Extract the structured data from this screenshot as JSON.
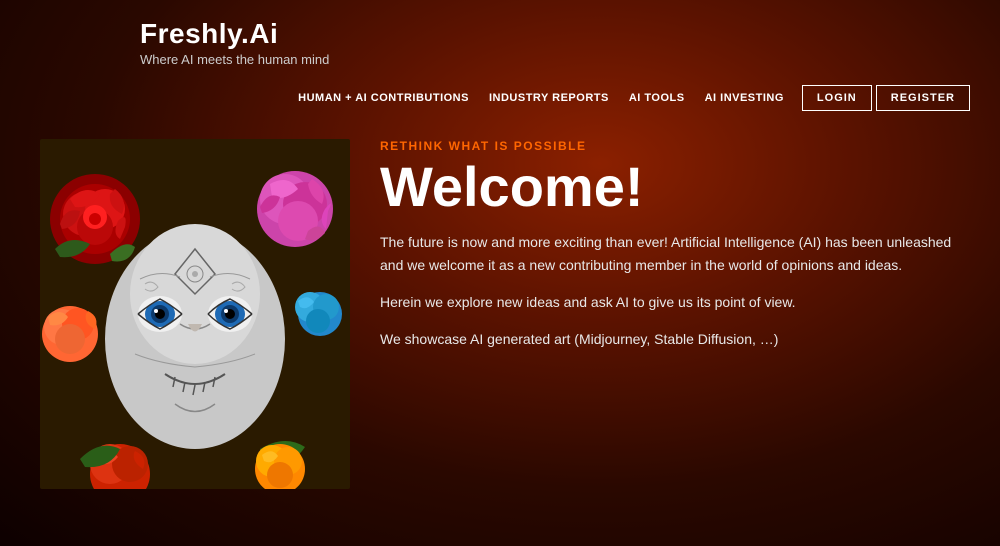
{
  "site": {
    "title": "Freshly.Ai",
    "tagline": "Where AI meets the human mind"
  },
  "nav": {
    "links": [
      {
        "label": "HUMAN + AI CONTRIBUTIONS",
        "href": "#"
      },
      {
        "label": "INDUSTRY REPORTS",
        "href": "#"
      },
      {
        "label": "AI TOOLS",
        "href": "#"
      },
      {
        "label": "AI INVESTING",
        "href": "#"
      }
    ],
    "login_label": "LOGIN",
    "register_label": "REGISTER"
  },
  "hero": {
    "eyebrow": "RETHINK WHAT IS POSSIBLE",
    "heading": "Welcome!",
    "paragraph1": "The future is now and more exciting than ever!  Artificial Intelligence (AI) has been unleashed and we welcome it as a new contributing member in the world of opinions and ideas.",
    "paragraph2": "Herein we explore new ideas and ask AI to give us its point of view.",
    "paragraph3": "We showcase AI generated art (Midjourney, Stable Diffusion, …)"
  },
  "colors": {
    "accent": "#ff6600",
    "background": "#1a0000",
    "text_primary": "#ffffff",
    "text_secondary": "#e8e8e8",
    "nav_border": "#ffffff"
  }
}
